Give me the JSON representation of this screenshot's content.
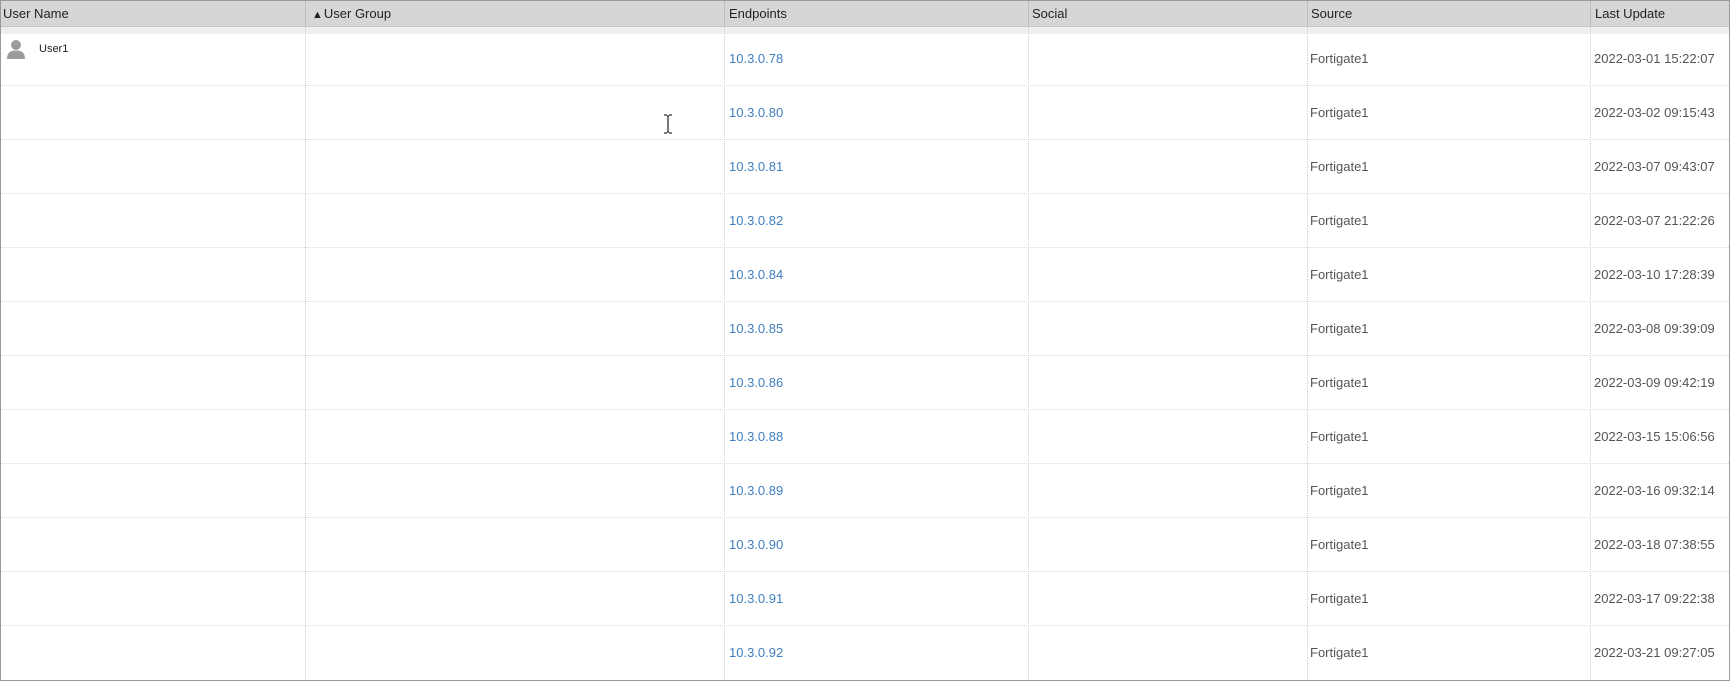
{
  "columns": {
    "user_name": "User Name",
    "user_group": "User Group",
    "user_group_sort": "▲",
    "endpoints": "Endpoints",
    "social": "Social",
    "source": "Source",
    "last_update": "Last Update"
  },
  "user": {
    "name": "User1",
    "icon": "user-icon"
  },
  "rows": [
    {
      "endpoint": "10.3.0.78",
      "source": "Fortigate1",
      "last_update": "2022-03-01 15:22:07"
    },
    {
      "endpoint": "10.3.0.80",
      "source": "Fortigate1",
      "last_update": "2022-03-02 09:15:43"
    },
    {
      "endpoint": "10.3.0.81",
      "source": "Fortigate1",
      "last_update": "2022-03-07 09:43:07"
    },
    {
      "endpoint": "10.3.0.82",
      "source": "Fortigate1",
      "last_update": "2022-03-07 21:22:26"
    },
    {
      "endpoint": "10.3.0.84",
      "source": "Fortigate1",
      "last_update": "2022-03-10 17:28:39"
    },
    {
      "endpoint": "10.3.0.85",
      "source": "Fortigate1",
      "last_update": "2022-03-08 09:39:09"
    },
    {
      "endpoint": "10.3.0.86",
      "source": "Fortigate1",
      "last_update": "2022-03-09 09:42:19"
    },
    {
      "endpoint": "10.3.0.88",
      "source": "Fortigate1",
      "last_update": "2022-03-15 15:06:56"
    },
    {
      "endpoint": "10.3.0.89",
      "source": "Fortigate1",
      "last_update": "2022-03-16 09:32:14"
    },
    {
      "endpoint": "10.3.0.90",
      "source": "Fortigate1",
      "last_update": "2022-03-18 07:38:55"
    },
    {
      "endpoint": "10.3.0.91",
      "source": "Fortigate1",
      "last_update": "2022-03-17 09:22:38"
    },
    {
      "endpoint": "10.3.0.92",
      "source": "Fortigate1",
      "last_update": "2022-03-21 09:27:05"
    }
  ],
  "colors": {
    "header_bg": "#d6d6d6",
    "link": "#3f7fbf",
    "text": "#555555"
  }
}
